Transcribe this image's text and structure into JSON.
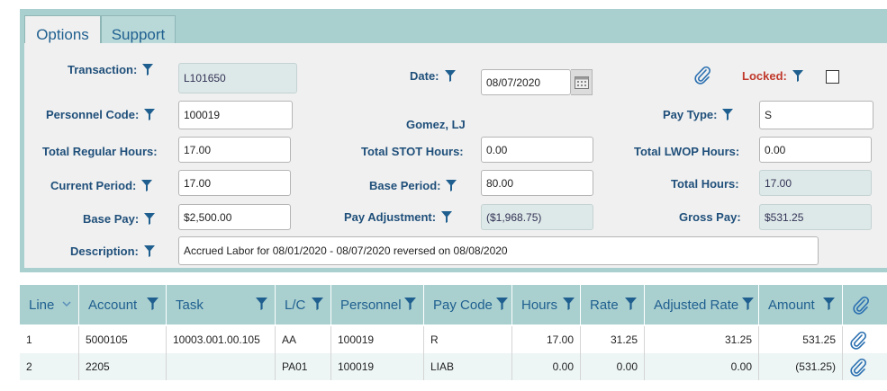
{
  "tabs": [
    {
      "label": "Options"
    },
    {
      "label": "Support"
    }
  ],
  "form": {
    "transaction": {
      "label": "Transaction:",
      "value": "L101650"
    },
    "date": {
      "label": "Date:",
      "value": "08/07/2020"
    },
    "locked": {
      "label": "Locked:",
      "checked": false
    },
    "personnel_code": {
      "label": "Personnel Code:",
      "value": "100019"
    },
    "personnel_name": "Gomez, LJ",
    "pay_type": {
      "label": "Pay Type:",
      "value": "S"
    },
    "total_regular_hours": {
      "label": "Total Regular Hours:",
      "value": "17.00"
    },
    "total_stot_hours": {
      "label": "Total STOT Hours:",
      "value": "0.00"
    },
    "total_lwop_hours": {
      "label": "Total LWOP Hours:",
      "value": "0.00"
    },
    "current_period": {
      "label": "Current Period:",
      "value": "17.00"
    },
    "base_period": {
      "label": "Base Period:",
      "value": "80.00"
    },
    "total_hours": {
      "label": "Total Hours:",
      "value": "17.00"
    },
    "base_pay": {
      "label": "Base Pay:",
      "value": "$2,500.00"
    },
    "pay_adjustment": {
      "label": "Pay Adjustment:",
      "value": "($1,968.75)"
    },
    "gross_pay": {
      "label": "Gross Pay:",
      "value": "$531.25"
    },
    "description": {
      "label": "Description:",
      "value": "Accrued Labor for 08/01/2020 - 08/07/2020 reversed on 08/08/2020"
    }
  },
  "grid": {
    "columns": [
      "Line",
      "Account",
      "Task",
      "L/C",
      "Personnel",
      "Pay Code",
      "Hours",
      "Rate",
      "Adjusted Rate",
      "Amount"
    ],
    "rows": [
      [
        "1",
        "5000105",
        "10003.001.00.105",
        "AA",
        "100019",
        "R",
        "17.00",
        "31.25",
        "31.25",
        "531.25"
      ],
      [
        "2",
        "2205",
        "",
        "PA01",
        "100019",
        "LIAB",
        "0.00",
        "0.00",
        "0.00",
        "(531.25)"
      ]
    ]
  },
  "colors": {
    "accent": "#1f5f8f",
    "header_bg": "#a9cfcf",
    "label": "#1f4f7a",
    "locked_label": "#c0392b"
  }
}
